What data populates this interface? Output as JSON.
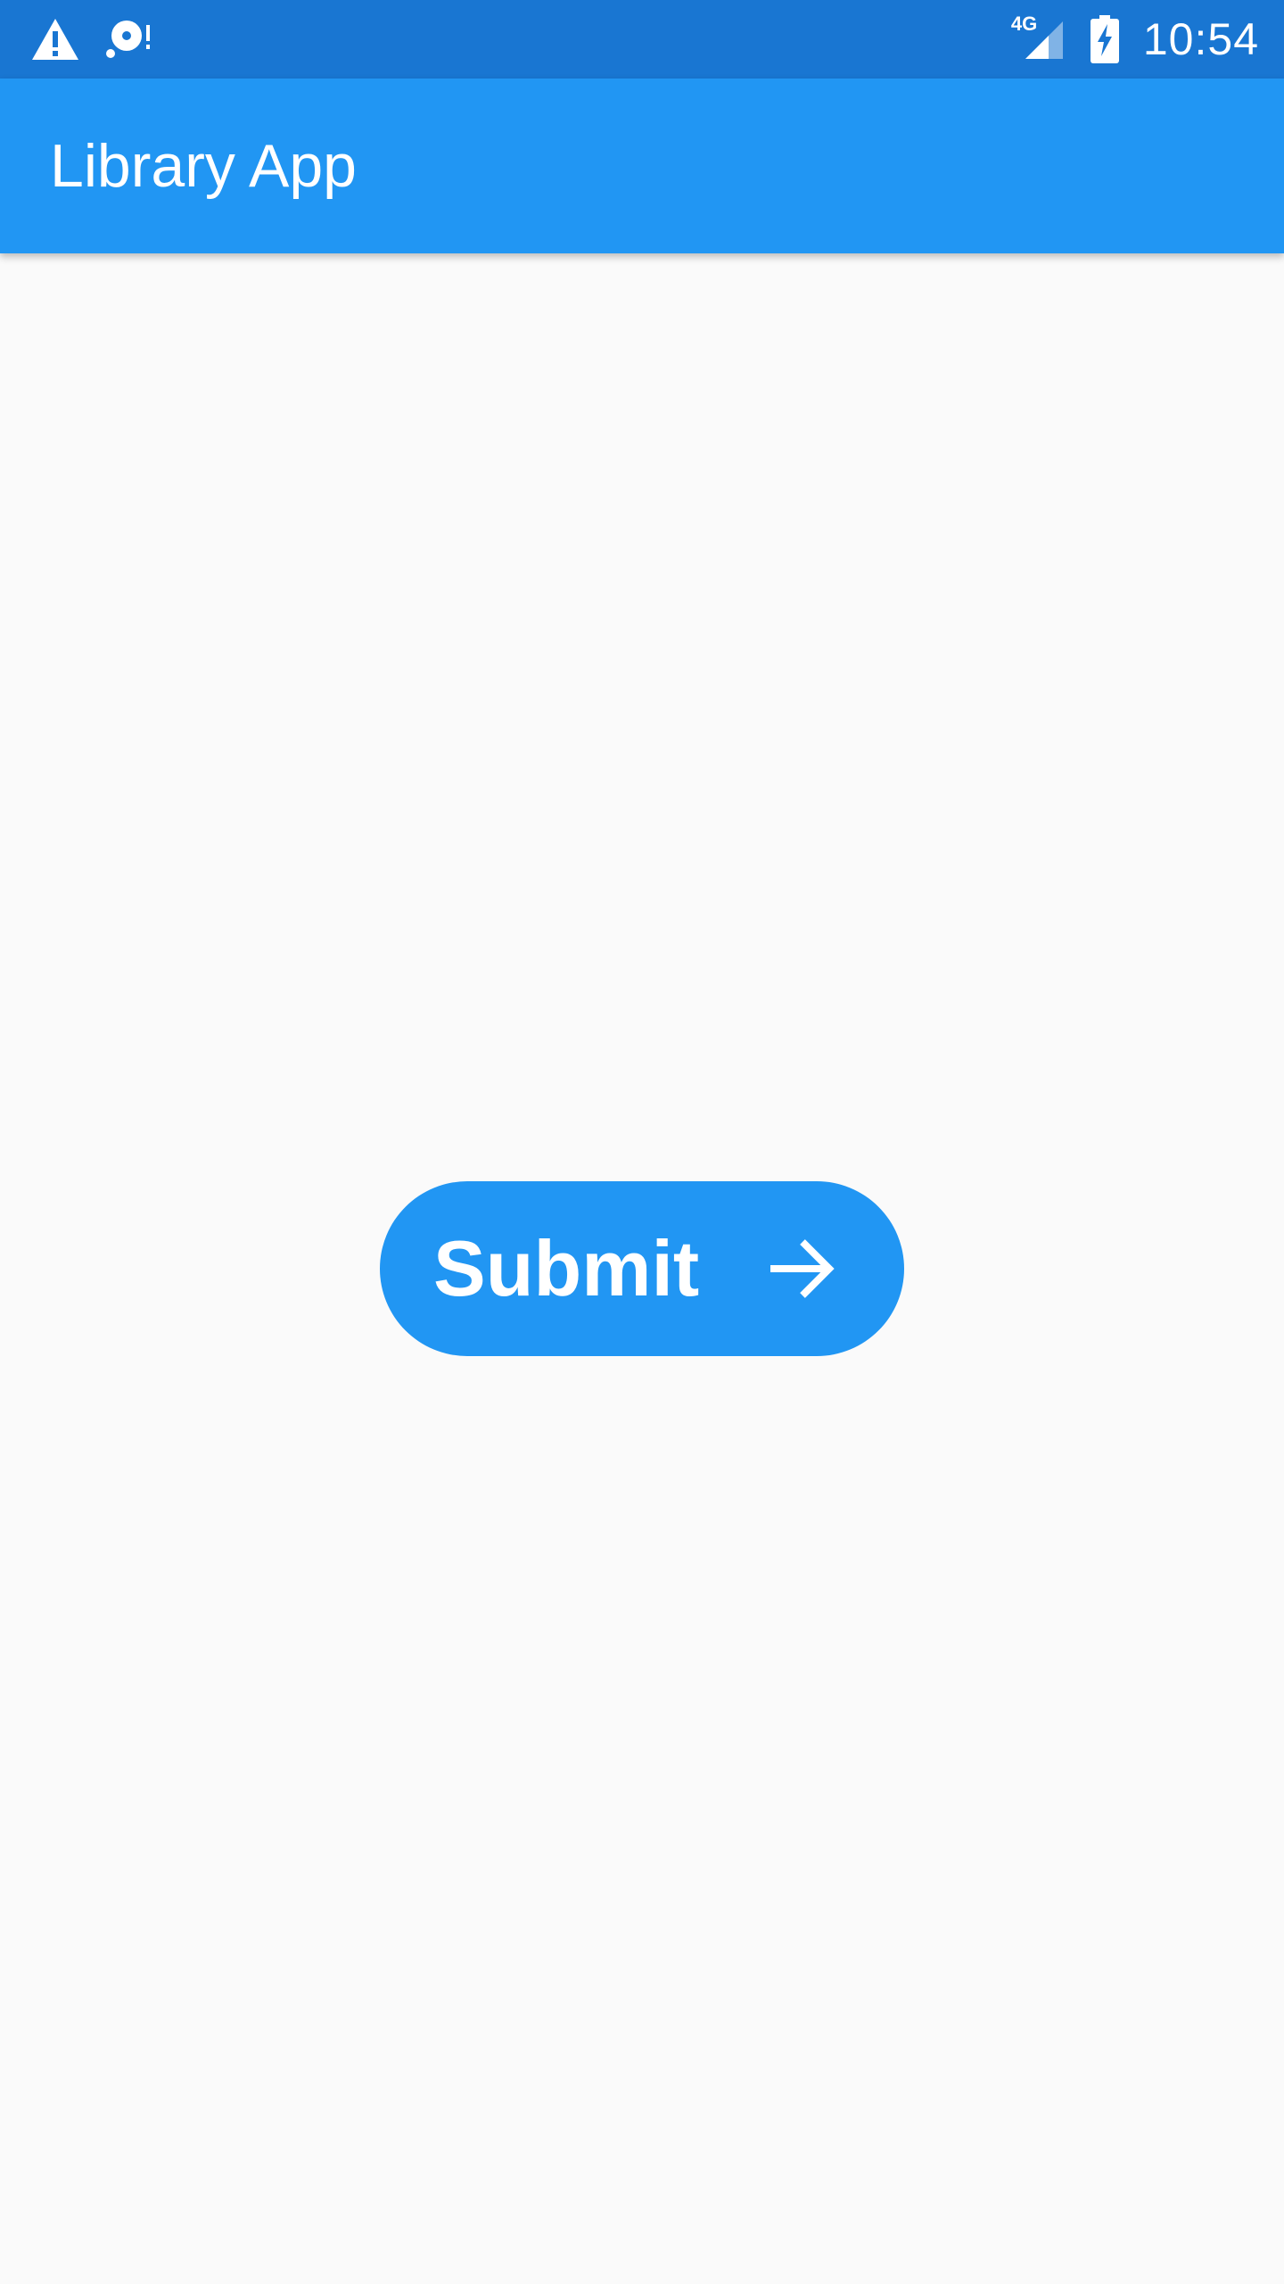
{
  "status_bar": {
    "time": "10:54",
    "network_label": "4G",
    "left_icons": [
      "warning-icon",
      "sd-card-alert-icon"
    ],
    "right_icons": [
      "signal-icon",
      "battery-charging-icon"
    ]
  },
  "app_bar": {
    "title": "Library App"
  },
  "main": {
    "submit_label": "Submit",
    "submit_icon": "arrow-forward-icon"
  },
  "colors": {
    "status_bar": "#1976d2",
    "primary": "#2196f3",
    "background": "#fafafa",
    "on_primary": "#ffffff"
  }
}
